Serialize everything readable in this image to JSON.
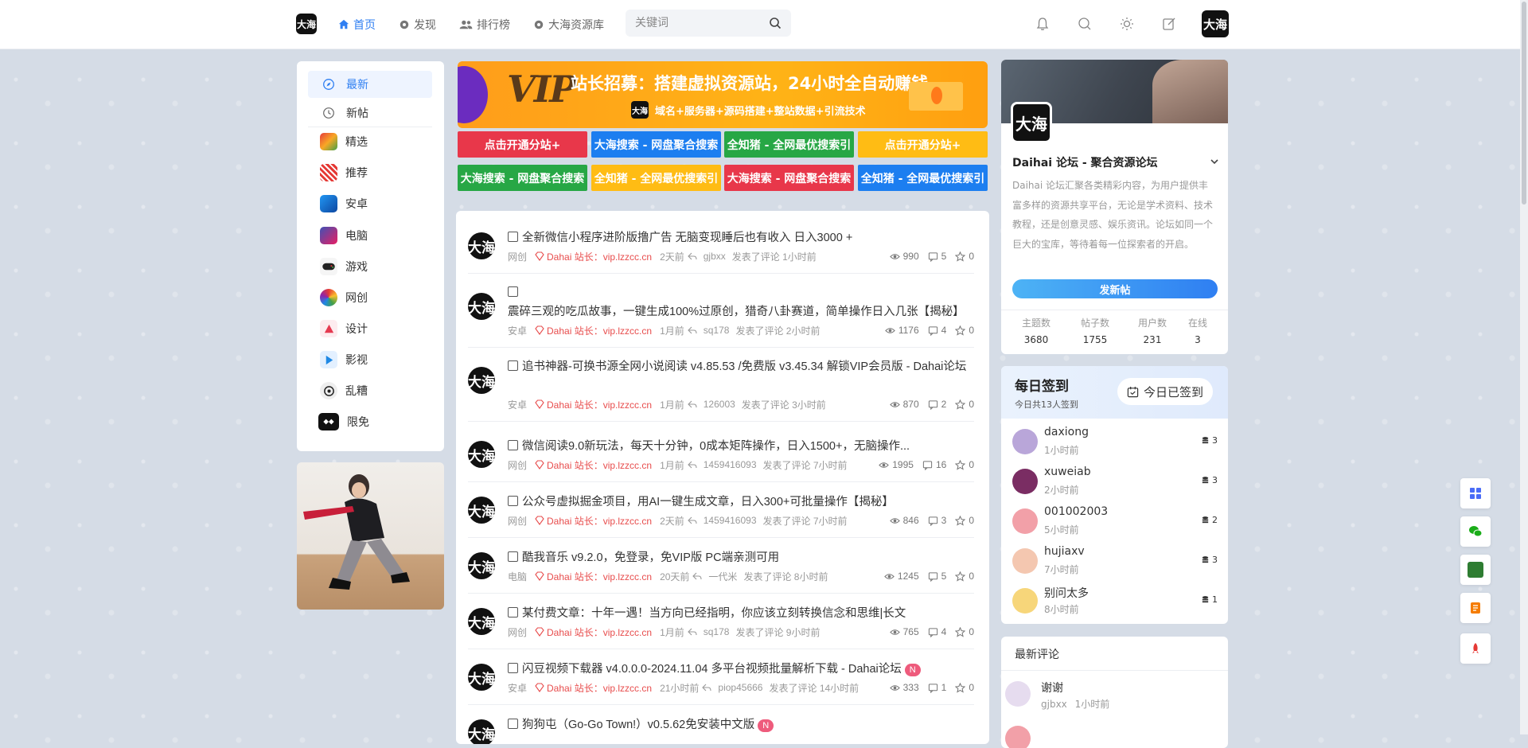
{
  "brand": {
    "logo_text": "大海"
  },
  "nav": {
    "items": [
      {
        "label": "首页"
      },
      {
        "label": "发现"
      },
      {
        "label": "排行榜"
      },
      {
        "label": "大海资源库"
      }
    ]
  },
  "search": {
    "placeholder": "关键词"
  },
  "categories": [
    {
      "label": "最新"
    },
    {
      "label": "新帖"
    },
    {
      "label": "精选"
    },
    {
      "label": "推荐"
    },
    {
      "label": "安卓"
    },
    {
      "label": "电脑"
    },
    {
      "label": "游戏"
    },
    {
      "label": "网创"
    },
    {
      "label": "设计"
    },
    {
      "label": "影视"
    },
    {
      "label": "乱糟"
    },
    {
      "label": "限免"
    }
  ],
  "banner": {
    "logo": "VIP",
    "title": "站长招募：搭建虚拟资源站，24小时全自动赚钱",
    "subtitle": "域名+服务器+源码搭建+整站数据+引流技术"
  },
  "buttons": [
    {
      "label": "点击开通分站+",
      "color": "#e8374a"
    },
    {
      "label": "大海搜索 - 网盘聚合搜索",
      "color": "#1c7ef0"
    },
    {
      "label": "全知猪 - 全网最优搜索引",
      "color": "#27a745"
    },
    {
      "label": "点击开通分站+",
      "color": "#ffbc14"
    },
    {
      "label": "大海搜索 - 网盘聚合搜索",
      "color": "#27a745"
    },
    {
      "label": "全知猪 - 全网最优搜索引",
      "color": "#ffbc14"
    },
    {
      "label": "大海搜索 - 网盘聚合搜索",
      "color": "#e8374a"
    },
    {
      "label": "全知猪 - 全网最优搜索引",
      "color": "#1c7ef0"
    }
  ],
  "posts": [
    {
      "title": "全新微信小程序进阶版撸广告 无脑变现睡后也有收入 日入3000 +",
      "section": "网创",
      "author": "Dahai 站长：vip.lzzcc.cn",
      "time": "2天前",
      "replier": "gjbxx",
      "reply_time": "发表了评论 1小时前",
      "views": "990",
      "comments": "5",
      "likes": "0",
      "new": ""
    },
    {
      "title": "震碎三观的吃瓜故事，一键生成100%过原创，猎奇八卦赛道，简单操作日入几张【揭秘】",
      "section": "安卓",
      "author": "Dahai 站长：vip.lzzcc.cn",
      "time": "1月前",
      "replier": "sq178",
      "reply_time": "发表了评论 2小时前",
      "views": "1176",
      "comments": "4",
      "likes": "0",
      "new": ""
    },
    {
      "title": "追书神器-可换书源全网小说阅读 v4.85.53 /免费版 v3.45.34 解锁VIP会员版 - Dahai论坛",
      "section": "安卓",
      "author": "Dahai 站长：vip.lzzcc.cn",
      "time": "1月前",
      "replier": "126003",
      "reply_time": "发表了评论 3小时前",
      "views": "870",
      "comments": "2",
      "likes": "0",
      "new": ""
    },
    {
      "title": "微信阅读9.0新玩法，每天十分钟，0成本矩阵操作，日入1500+，无脑操作...",
      "section": "网创",
      "author": "Dahai 站长：vip.lzzcc.cn",
      "time": "1月前",
      "replier": "1459416093",
      "reply_time": "发表了评论 7小时前",
      "views": "1995",
      "comments": "16",
      "likes": "0",
      "new": ""
    },
    {
      "title": "公众号虚拟掘金项目，用AI一键生成文章，日入300+可批量操作【揭秘】",
      "section": "网创",
      "author": "Dahai 站长：vip.lzzcc.cn",
      "time": "2天前",
      "replier": "1459416093",
      "reply_time": "发表了评论 7小时前",
      "views": "846",
      "comments": "3",
      "likes": "0",
      "new": ""
    },
    {
      "title": "酷我音乐 v9.2.0，免登录，免VIP版 PC端亲测可用",
      "section": "电脑",
      "author": "Dahai 站长：vip.lzzcc.cn",
      "time": "20天前",
      "replier": "一代米",
      "reply_time": "发表了评论 8小时前",
      "views": "1245",
      "comments": "5",
      "likes": "0",
      "new": ""
    },
    {
      "title": "某付费文章：十年一遇！当方向已经指明，你应该立刻转换信念和思维|长文",
      "section": "网创",
      "author": "Dahai 站长：vip.lzzcc.cn",
      "time": "1月前",
      "replier": "sq178",
      "reply_time": "发表了评论 9小时前",
      "views": "765",
      "comments": "4",
      "likes": "0",
      "new": ""
    },
    {
      "title": "闪豆视频下载器 v4.0.0.0-2024.11.04 多平台视频批量解析下载 - Dahai论坛",
      "section": "安卓",
      "author": "Dahai 站长：vip.lzzcc.cn",
      "time": "21小时前",
      "replier": "piop45666",
      "reply_time": "发表了评论 14小时前",
      "views": "333",
      "comments": "1",
      "likes": "0",
      "new": "N"
    },
    {
      "title": "狗狗屯（Go-Go Town!）v0.5.62免安装中文版",
      "section": "",
      "author": "",
      "time": "",
      "replier": "",
      "reply_time": "",
      "views": "",
      "comments": "",
      "likes": "",
      "new": "N"
    }
  ],
  "forum": {
    "name": "Daihai 论坛 - 聚合资源论坛",
    "desc": "Daihai 论坛汇聚各类精彩内容，为用户提供丰富多样的资源共享平台，无论是学术资料、技术教程，还是创意灵感、娱乐资讯。论坛如同一个巨大的宝库，等待着每一位探索者的开启。",
    "post_btn": "发新帖",
    "stats": [
      {
        "label": "主题数",
        "value": "3680"
      },
      {
        "label": "帖子数",
        "value": "1755"
      },
      {
        "label": "用户数",
        "value": "231"
      },
      {
        "label": "在线",
        "value": "3"
      }
    ]
  },
  "signin": {
    "title": "每日签到",
    "sub": "今日共13人签到",
    "btn": "今日已签到",
    "users": [
      {
        "name": "daxiong",
        "time": "1小时前",
        "count": "3",
        "color": "#b9a6d9"
      },
      {
        "name": "xuweiab",
        "time": "2小时前",
        "count": "3",
        "color": "#7a2d63"
      },
      {
        "name": "001002003",
        "time": "5小时前",
        "count": "2",
        "color": "#f2a0a8"
      },
      {
        "name": "hujiaxv",
        "time": "7小时前",
        "count": "3",
        "color": "#f4c7b0"
      },
      {
        "name": "别问太多",
        "time": "8小时前",
        "count": "1",
        "color": "#f7d67a"
      }
    ]
  },
  "comments": {
    "title": "最新评论",
    "items": [
      {
        "text": "谢谢",
        "user": "gjbxx",
        "time": "1小时前"
      }
    ]
  }
}
